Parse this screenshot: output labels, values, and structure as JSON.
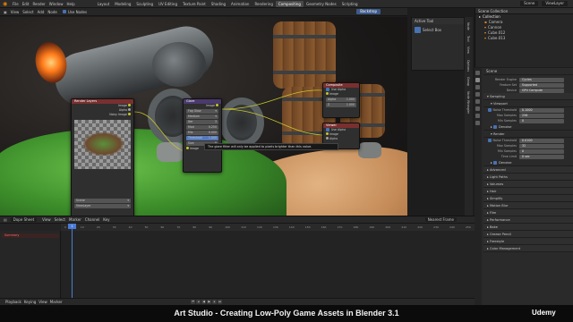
{
  "app": {
    "menu": [
      "File",
      "Edit",
      "Render",
      "Window",
      "Help"
    ],
    "workspaces": [
      "Layout",
      "Modeling",
      "Sculpting",
      "UV Editing",
      "Texture Paint",
      "Shading",
      "Animation",
      "Rendering",
      "Compositing",
      "Geometry Nodes",
      "Scripting"
    ],
    "active_workspace": "Compositing",
    "scene_label": "Scene",
    "view_layer_label": "ViewLayer"
  },
  "viewport": {
    "menu": [
      "View",
      "Select",
      "Add",
      "Node"
    ],
    "use_nodes": "Use Nodes",
    "render_button": "Backdrop"
  },
  "nodes": {
    "render_layers": {
      "title": "Render Layers",
      "outputs": [
        "Image",
        "Alpha",
        "Noisy Image"
      ],
      "scene": "Scene",
      "layer": "ViewLayer"
    },
    "glare": {
      "title": "Glare",
      "output": "Image",
      "type": "Fog Glow",
      "quality": "Medium",
      "iterations": "3",
      "color_mod": "0.250",
      "mix": "0.000",
      "threshold_label": "Threshold",
      "threshold": "1.000",
      "size": "8",
      "input": "Image"
    },
    "composite": {
      "title": "Composite",
      "use_alpha": "Use Alpha",
      "inputs": [
        "Image",
        "Alpha",
        "Z"
      ],
      "alpha_val": "1.000",
      "z_val": "1.000"
    },
    "viewer": {
      "title": "Viewer",
      "use_alpha": "Use Alpha",
      "inputs": [
        "Image",
        "Alpha"
      ]
    },
    "tooltip": "The glare filter will only be applied to pixels brighter than this value."
  },
  "active_tool": {
    "title": "Active Tool",
    "item": "Select Box"
  },
  "npanel_tabs": [
    "Node",
    "Tool",
    "View",
    "Options",
    "Group",
    "Node Wrangler"
  ],
  "outliner": {
    "title": "Scene Collection",
    "items": [
      "Collection",
      "Camera",
      "Cannon",
      "Cube.012",
      "Cube.013"
    ]
  },
  "properties": {
    "scene": "Scene",
    "render_engine_label": "Render Engine",
    "render_engine": "Cycles",
    "feature_set_label": "Feature Set",
    "feature_set": "Supported",
    "device_label": "Device",
    "device": "GPU Compute",
    "sampling": "Sampling",
    "viewport": "Viewport",
    "noise_threshold_label": "Noise Threshold",
    "viewport_noise_threshold": "0.1000",
    "max_samples_label": "Max Samples",
    "viewport_max_samples": "256",
    "min_samples_label": "Min Samples",
    "viewport_min_samples": "0",
    "denoise": "Denoise",
    "render": "Render",
    "render_noise_threshold": "0.0100",
    "render_max_samples": "32",
    "render_min_samples": "0",
    "time_limit_label": "Time Limit",
    "time_limit": "0 sec",
    "render_denoise": "Denoise",
    "sections": [
      "Advanced",
      "Light Paths",
      "Volumes",
      "Hair",
      "Simplify",
      "Motion Blur",
      "Film",
      "Performance",
      "Bake",
      "Grease Pencil",
      "Freestyle",
      "Color Management"
    ]
  },
  "timeline": {
    "mode": "Dope Sheet",
    "menu": [
      "View",
      "Select",
      "Marker",
      "Channel",
      "Key"
    ],
    "filter": "Nearest Frame",
    "summary": "Summary",
    "current_frame": "1",
    "ticks": [
      "0",
      "10",
      "20",
      "30",
      "40",
      "50",
      "60",
      "70",
      "80",
      "90",
      "100",
      "110",
      "120",
      "130",
      "140",
      "150",
      "160",
      "170",
      "180",
      "190",
      "200",
      "210",
      "220",
      "230",
      "240",
      "250"
    ],
    "footer": [
      "Playback",
      "Keying",
      "View",
      "Marker"
    ]
  },
  "caption": "Art Studio - Creating Low-Poly Game Assets in Blender 3.1",
  "brand": "Udemy"
}
